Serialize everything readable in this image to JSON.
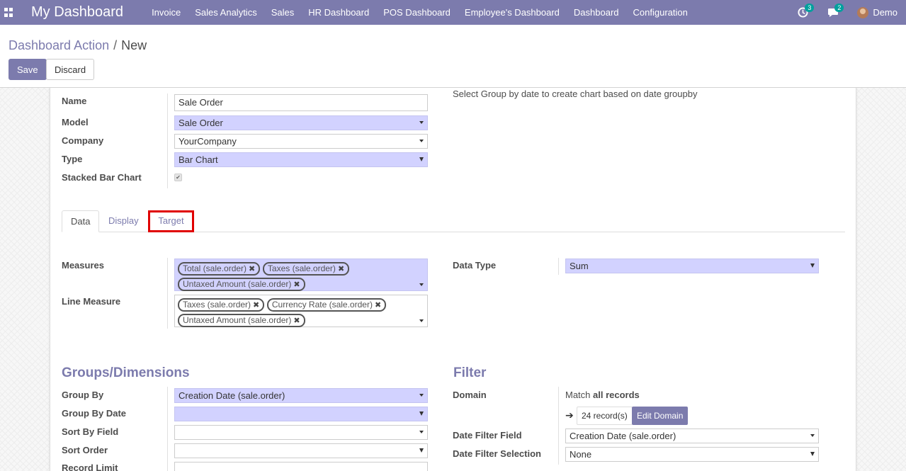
{
  "navbar": {
    "brand": "My Dashboard",
    "menu": [
      "Invoice",
      "Sales Analytics",
      "Sales",
      "HR Dashboard",
      "POS Dashboard",
      "Employee's Dashboard",
      "Dashboard",
      "Configuration"
    ],
    "activity_count": "3",
    "messages_count": "2",
    "user": "Demo",
    "accent_color": "#7c7bad"
  },
  "control": {
    "breadcrumb_parent": "Dashboard Action",
    "breadcrumb_separator": "/",
    "breadcrumb_current": "New",
    "save_label": "Save",
    "discard_label": "Discard"
  },
  "form": {
    "name_label": "Name",
    "name_value": "Sale Order",
    "model_label": "Model",
    "model_value": "Sale Order",
    "company_label": "Company",
    "company_value": "YourCompany",
    "type_label": "Type",
    "type_value": "Bar Chart",
    "stacked_label": "Stacked Bar Chart",
    "stacked_checked": true,
    "hint": "Select Group by date to create chart based on date groupby"
  },
  "tabs": [
    {
      "label": "Data",
      "active": true
    },
    {
      "label": "Display",
      "active": false
    },
    {
      "label": "Target",
      "active": false,
      "highlighted": true
    }
  ],
  "data_tab": {
    "measures_label": "Measures",
    "measures": [
      "Total (sale.order)",
      "Taxes (sale.order)",
      "Untaxed Amount (sale.order)"
    ],
    "line_measure_label": "Line Measure",
    "line_measures": [
      "Taxes (sale.order)",
      "Currency Rate (sale.order)",
      "Untaxed Amount (sale.order)"
    ],
    "data_type_label": "Data Type",
    "data_type_value": "Sum"
  },
  "groups": {
    "title": "Groups/Dimensions",
    "group_by_label": "Group By",
    "group_by_value": "Creation Date (sale.order)",
    "group_by_date_label": "Group By Date",
    "group_by_date_value": "",
    "sort_by_field_label": "Sort By Field",
    "sort_by_field_value": "",
    "sort_order_label": "Sort Order",
    "sort_order_value": "",
    "record_limit_label": "Record Limit",
    "record_limit_value": ""
  },
  "filter": {
    "title": "Filter",
    "domain_label": "Domain",
    "domain_prefix": "Match",
    "domain_value": "all records",
    "records_button": "24 record(s)",
    "edit_domain_button": "Edit Domain",
    "date_filter_field_label": "Date Filter Field",
    "date_filter_field_value": "Creation Date (sale.order)",
    "date_filter_selection_label": "Date Filter Selection",
    "date_filter_selection_value": "None"
  }
}
